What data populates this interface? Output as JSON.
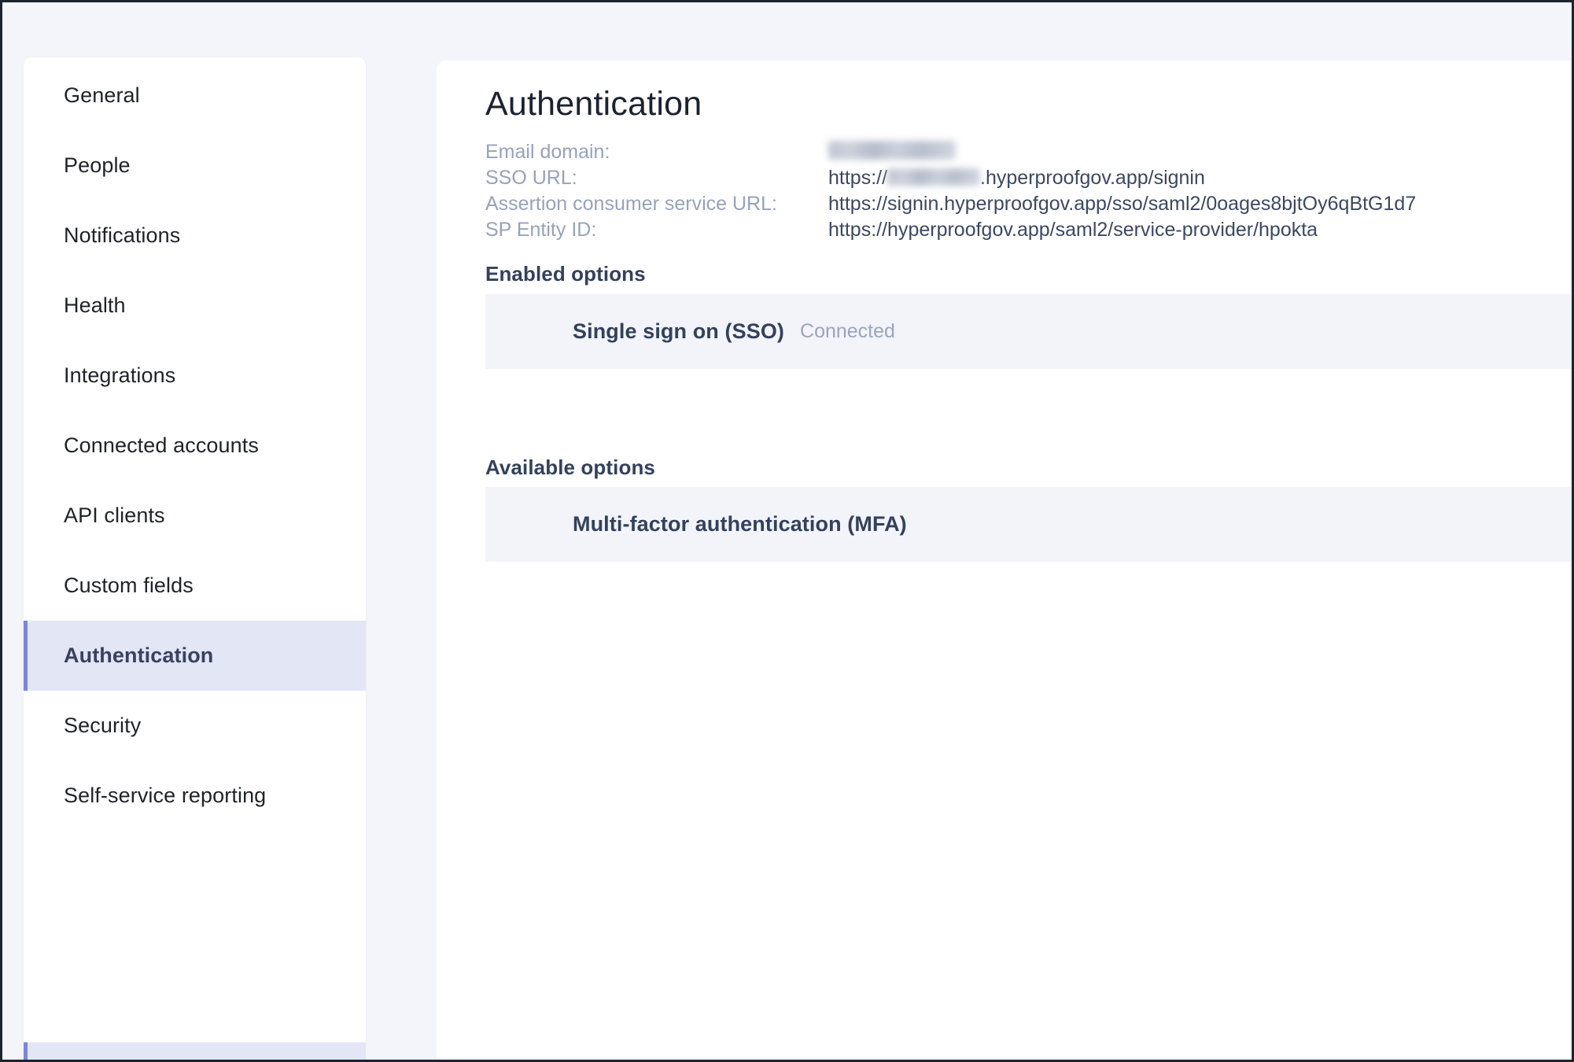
{
  "sidebar": {
    "items": [
      {
        "label": "General",
        "selected": false
      },
      {
        "label": "People",
        "selected": false
      },
      {
        "label": "Notifications",
        "selected": false
      },
      {
        "label": "Health",
        "selected": false
      },
      {
        "label": "Integrations",
        "selected": false
      },
      {
        "label": "Connected accounts",
        "selected": false
      },
      {
        "label": "API clients",
        "selected": false
      },
      {
        "label": "Custom fields",
        "selected": false
      },
      {
        "label": "Authentication",
        "selected": true
      },
      {
        "label": "Security",
        "selected": false
      },
      {
        "label": "Self-service reporting",
        "selected": false
      }
    ]
  },
  "main": {
    "title": "Authentication",
    "details": [
      {
        "label": "Email domain:",
        "value_prefix": "",
        "redacted": "domain",
        "value_suffix": ""
      },
      {
        "label": "SSO URL:",
        "value_prefix": "https://",
        "redacted": "subdomain",
        "value_suffix": ".hyperproofgov.app/signin"
      },
      {
        "label": "Assertion consumer service URL:",
        "value_prefix": "https://signin.hyperproofgov.app/sso/saml2/0oages8bjtOy6qBtG1d7",
        "redacted": "",
        "value_suffix": ""
      },
      {
        "label": "SP Entity ID:",
        "value_prefix": "https://hyperproofgov.app/saml2/service-provider/hpokta",
        "redacted": "",
        "value_suffix": ""
      }
    ],
    "enabled_section": {
      "heading": "Enabled options",
      "options": [
        {
          "name": "Single sign on (SSO)",
          "status": "Connected"
        }
      ]
    },
    "available_section": {
      "heading": "Available options",
      "options": [
        {
          "name": "Multi-factor authentication (MFA)",
          "status": ""
        }
      ]
    }
  },
  "colors": {
    "page_background": "#f3f5fa",
    "panel_background": "#ffffff",
    "selected_nav_background": "#e2e6f5",
    "selected_nav_accent": "#7b86d4",
    "option_row_background": "#f2f4f9",
    "heading_text": "#33415c",
    "muted_label_text": "#97a2ba",
    "value_text": "#3c4862"
  }
}
